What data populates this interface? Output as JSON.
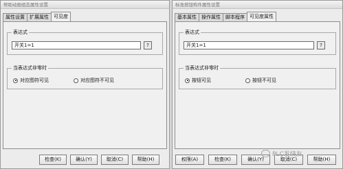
{
  "left_dialog": {
    "title": "帮助动画组态属性设置",
    "tabs": [
      "属性设置",
      "扩展属性",
      "可见度"
    ],
    "active_tab": "可见度",
    "expression_group_title": "表达式",
    "expression_value": "开关1=1",
    "question_button": "?",
    "visibility_group_title": "当表达式非零时",
    "radio_options": [
      {
        "label": "对应图符可见",
        "checked": true
      },
      {
        "label": "对应图符不可见",
        "checked": false
      }
    ],
    "buttons": [
      "检查(K)",
      "确认(Y)",
      "取消(C)",
      "帮助(H)"
    ]
  },
  "right_dialog": {
    "title": "标准按钮构件属性设置",
    "tabs": [
      "基本属性",
      "操作属性",
      "脚本程序",
      "可见度属性"
    ],
    "active_tab": "可见度属性",
    "expression_group_title": "表达式",
    "expression_value": "开关1=1",
    "question_button": "?",
    "visibility_group_title": "当表达式非零时",
    "radio_options": [
      {
        "label": "按钮可见",
        "checked": true
      },
      {
        "label": "按钮不可见",
        "checked": false
      }
    ],
    "buttons": [
      "权限(A)",
      "检查(K)",
      "确认(Y)",
      "取消(C)",
      "帮助(H)"
    ]
  },
  "watermark": {
    "text": "PLC发烧友",
    "icon": "chat-bubble-icon"
  }
}
